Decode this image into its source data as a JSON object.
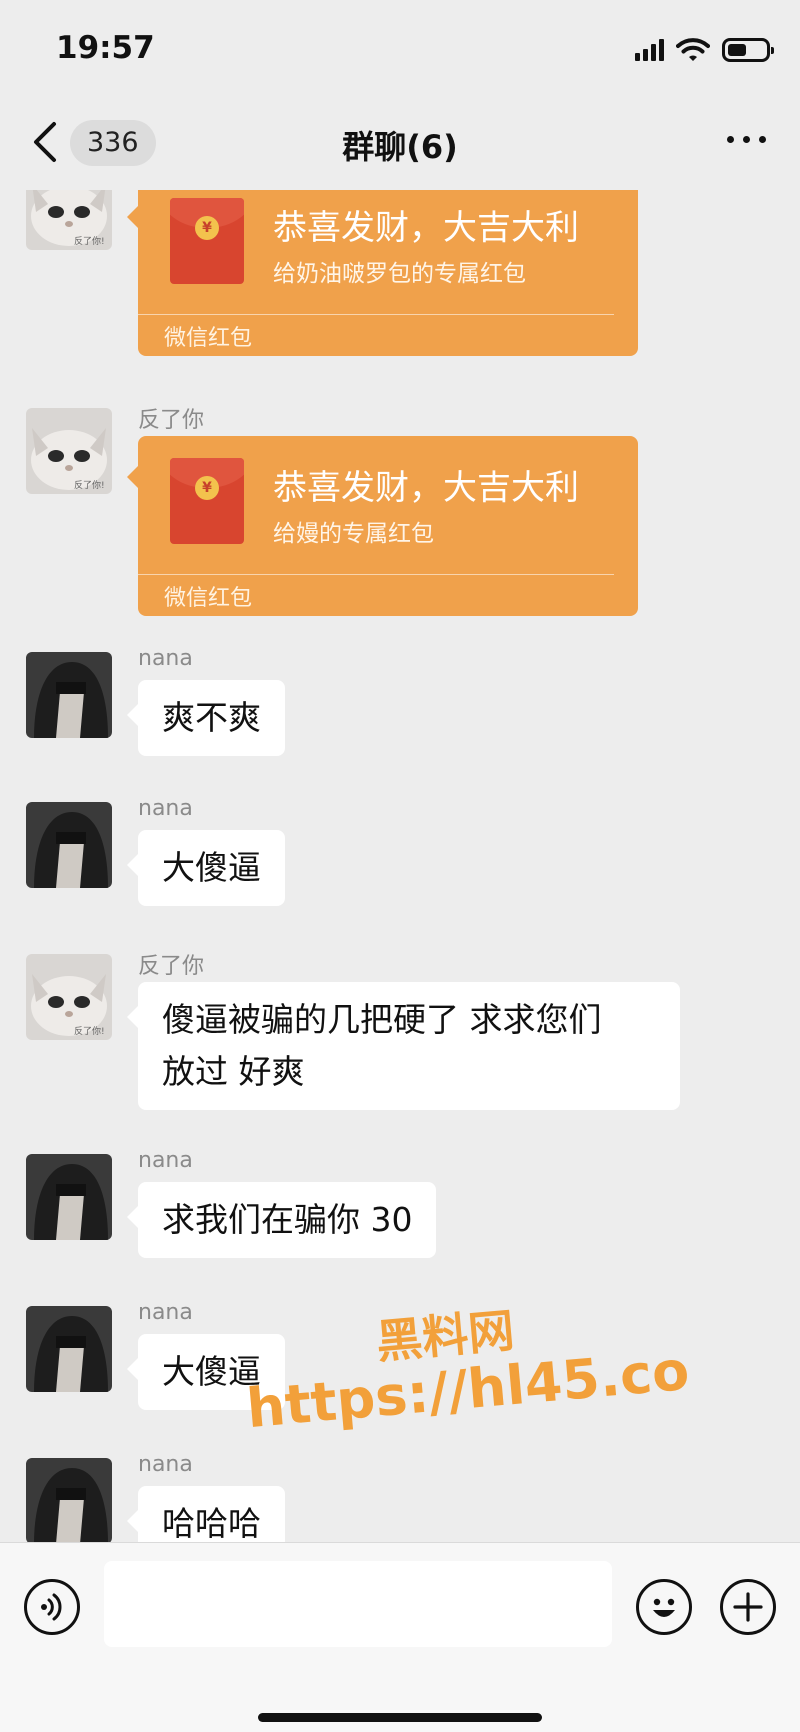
{
  "status_bar": {
    "time": "19:57",
    "icons": [
      "signal-icon",
      "wifi-icon",
      "battery-icon"
    ],
    "battery_level": 0.5
  },
  "nav": {
    "back_icon": "chevron-left-icon",
    "unread_count": "336",
    "title": "群聊(6)",
    "more_icon": "more-dots-icon"
  },
  "messages": [
    {
      "type": "hongbao",
      "title": "恭喜发财，大吉大利",
      "subtitle": "给奶油啵罗包的专属红包",
      "label": "微信红包",
      "avatar": "cat-avatar"
    },
    {
      "type": "hongbao",
      "sender": "反了你",
      "title": "恭喜发财，大吉大利",
      "subtitle": "给嫚的专属红包",
      "label": "微信红包",
      "avatar": "cat-avatar"
    },
    {
      "type": "text",
      "sender": "nana",
      "text": "爽不爽",
      "avatar": "hooded-avatar"
    },
    {
      "type": "text",
      "sender": "nana",
      "text": "大傻逼",
      "avatar": "hooded-avatar"
    },
    {
      "type": "text",
      "sender": "反了你",
      "lines": [
        "傻逼被骗的几把硬了 求求您们",
        "放过 好爽"
      ],
      "avatar": "cat-avatar"
    },
    {
      "type": "text",
      "sender": "nana",
      "text": "求我们在骗你 30",
      "avatar": "hooded-avatar"
    },
    {
      "type": "text",
      "sender": "nana",
      "text": "大傻逼",
      "avatar": "hooded-avatar"
    },
    {
      "type": "text",
      "sender": "nana",
      "text": "哈哈哈",
      "avatar": "hooded-avatar"
    }
  ],
  "avatar_labels": {
    "cat": "反了你!"
  },
  "hongbao_coin_symbol": "¥",
  "watermark": {
    "site": "黑料网",
    "url": "https://hl45.co",
    "color": "#f2a03a"
  },
  "input_bar": {
    "placeholder": "",
    "icons": [
      "voice-icon",
      "emoji-icon",
      "plus-icon"
    ]
  },
  "colors": {
    "background": "#ededed",
    "bubble": "#ffffff",
    "hongbao": "#f0a14b",
    "hongbao_envelope": "#d8452f"
  }
}
